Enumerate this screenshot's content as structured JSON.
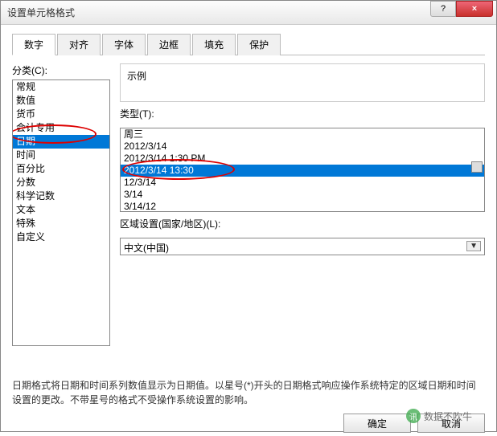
{
  "title": "设置单元格格式",
  "titlebar": {
    "help": "?",
    "close": "×"
  },
  "tabs": [
    {
      "label": "数字",
      "active": true
    },
    {
      "label": "对齐",
      "active": false
    },
    {
      "label": "字体",
      "active": false
    },
    {
      "label": "边框",
      "active": false
    },
    {
      "label": "填充",
      "active": false
    },
    {
      "label": "保护",
      "active": false
    }
  ],
  "category_label": "分类(C):",
  "categories": [
    {
      "label": "常规",
      "selected": false
    },
    {
      "label": "数值",
      "selected": false
    },
    {
      "label": "货币",
      "selected": false
    },
    {
      "label": "会计专用",
      "selected": false
    },
    {
      "label": "日期",
      "selected": true
    },
    {
      "label": "时间",
      "selected": false
    },
    {
      "label": "百分比",
      "selected": false
    },
    {
      "label": "分数",
      "selected": false
    },
    {
      "label": "科学记数",
      "selected": false
    },
    {
      "label": "文本",
      "selected": false
    },
    {
      "label": "特殊",
      "selected": false
    },
    {
      "label": "自定义",
      "selected": false
    }
  ],
  "sample_label": "示例",
  "type_label": "类型(T):",
  "types": [
    {
      "label": "周三",
      "selected": false
    },
    {
      "label": "2012/3/14",
      "selected": false
    },
    {
      "label": "2012/3/14 1:30 PM",
      "selected": false
    },
    {
      "label": "2012/3/14 13:30",
      "selected": true
    },
    {
      "label": "12/3/14",
      "selected": false
    },
    {
      "label": "3/14",
      "selected": false
    },
    {
      "label": "3/14/12",
      "selected": false
    }
  ],
  "locale_label": "区域设置(国家/地区)(L):",
  "locale_value": "中文(中国)",
  "description": "日期格式将日期和时间系列数值显示为日期值。以星号(*)开头的日期格式响应操作系统特定的区域日期和时间设置的更改。不带星号的格式不受操作系统设置的影响。",
  "footer": {
    "ok": "确定",
    "cancel": "取消"
  },
  "watermark": "数据不吹牛"
}
